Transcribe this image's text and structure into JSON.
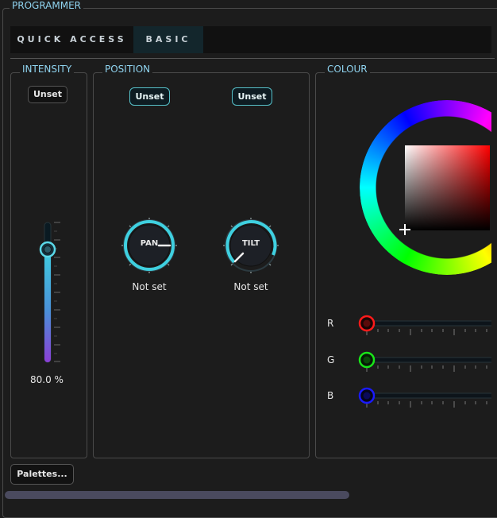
{
  "programmer": {
    "title": "PROGRAMMER"
  },
  "tabs": [
    {
      "label": "QUICK ACCESS",
      "active": false
    },
    {
      "label": "BASIC",
      "active": true
    }
  ],
  "intensity": {
    "legend": "INTENSITY",
    "unset_label": "Unset",
    "value_text": "80.0 %",
    "level": 0.8
  },
  "position": {
    "legend": "POSITION",
    "pan": {
      "unset_label": "Unset",
      "knob_label": "PAN",
      "status": "Not set"
    },
    "tilt": {
      "unset_label": "Unset",
      "knob_label": "TILT",
      "status": "Not set"
    }
  },
  "colour": {
    "legend": "COLOUR",
    "channels": [
      {
        "label": "R",
        "color": "#ff1a1a"
      },
      {
        "label": "G",
        "color": "#19e619"
      },
      {
        "label": "B",
        "color": "#1a1aff"
      }
    ]
  },
  "palettes_button": "Palettes...",
  "accent_color": "#3fd0e0"
}
